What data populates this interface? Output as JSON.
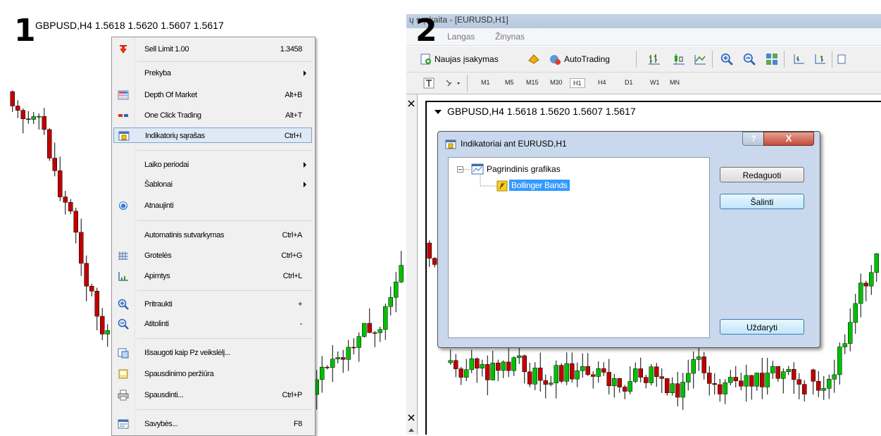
{
  "step_labels": {
    "left": "1",
    "right": "2"
  },
  "left_chart": {
    "header": "GBPUSD,H4  1.5618 1.5620 1.5607 1.5617"
  },
  "context_menu": {
    "items": [
      {
        "label": "Sell Limit 1.00",
        "shortcut": "1.3458",
        "icon": "sell-arrow-icon"
      },
      {
        "label": "Prekyba",
        "submenu": true
      },
      {
        "label": "Depth Of Market",
        "shortcut": "Alt+B",
        "icon": "depth-of-market-icon"
      },
      {
        "label": "One Click Trading",
        "shortcut": "Alt+T",
        "icon": "one-click-trading-icon"
      },
      {
        "label": "Indikatorių sąrašas",
        "shortcut": "Ctrl+I",
        "icon": "indicators-list-icon",
        "highlighted": true
      },
      {
        "label": "Laiko periodai",
        "submenu": true
      },
      {
        "label": "Šablonai",
        "submenu": true
      },
      {
        "label": "Atnaujinti",
        "icon": "refresh-icon"
      },
      {
        "label": "Automatinis sutvarkymas",
        "shortcut": "Ctrl+A"
      },
      {
        "label": "Grotelės",
        "shortcut": "Ctrl+G",
        "icon": "grid-icon"
      },
      {
        "label": "Apimtys",
        "shortcut": "Ctrl+L",
        "icon": "volumes-icon"
      },
      {
        "label": "Pritraukti",
        "shortcut": "+",
        "icon": "zoom-in-icon"
      },
      {
        "label": "Atitolinti",
        "shortcut": "-",
        "icon": "zoom-out-icon"
      },
      {
        "label": "Išsaugoti kaip Pz veikslėlį...",
        "icon": "save-picture-icon"
      },
      {
        "label": "Spausdinimo peržiūra",
        "icon": "print-preview-icon"
      },
      {
        "label": "Spausdinti...",
        "shortcut": "Ctrl+P",
        "icon": "print-icon"
      },
      {
        "label": "Savybės...",
        "shortcut": "F8",
        "icon": "properties-icon"
      }
    ]
  },
  "right_window": {
    "title": "ų sąskaita - [EURUSD,H1]",
    "menu": [
      "Langas",
      "Žinynas"
    ],
    "toolbar": {
      "new_order": "Naujas įsakymas",
      "autotrading": "AutoTrading"
    },
    "timeframes": [
      "M1",
      "M5",
      "M15",
      "M30",
      "H1",
      "H4",
      "D1",
      "W1",
      "MN"
    ],
    "selected_timeframe": "H1",
    "chart_header": "GBPUSD,H4  1.5618 1.5620 1.5607 1.5617"
  },
  "dialog": {
    "title": "Indikatoriai ant EURUSD,H1",
    "help_label": "?",
    "close_label": "X",
    "tree": {
      "root": "Pagrindinis grafikas",
      "child": "Bollinger Bands"
    },
    "buttons": {
      "edit": "Redaguoti",
      "delete": "Šalinti",
      "close": "Uždaryti"
    }
  },
  "colors": {
    "bull": "#00c000",
    "bear": "#c00000",
    "highlight": "#3399ff",
    "dialog_frame": "#c9d8ec"
  }
}
